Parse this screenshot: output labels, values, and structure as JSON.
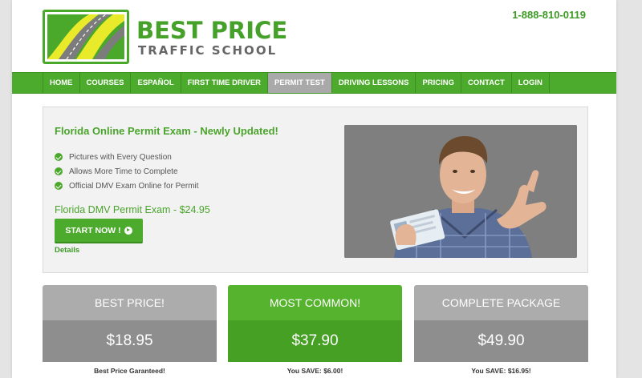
{
  "header": {
    "logo_line1": "BEST PRICE",
    "logo_line2": "TRAFFIC SCHOOL",
    "phone": "1-888-810-0119"
  },
  "nav": {
    "items": [
      "HOME",
      "COURSES",
      "ESPAÑOL",
      "FIRST TIME DRIVER",
      "PERMIT TEST",
      "DRIVING LESSONS",
      "PRICING",
      "CONTACT",
      "LOGIN"
    ],
    "active": "PERMIT TEST"
  },
  "promo": {
    "title": "Florida Online Permit Exam - Newly Updated!",
    "features": [
      "Pictures with Every Question",
      "Allows More Time to Complete",
      "Official DMV Exam Online for Permit"
    ],
    "price_line": "Florida DMV Permit Exam - $24.95",
    "cta_label": "START NOW !",
    "details_label": "Details"
  },
  "pricing": [
    {
      "heading": "BEST PRICE!",
      "price": "$18.95",
      "note": "Best Price Garanteed!",
      "color": "#acacac"
    },
    {
      "heading": "MOST COMMON!",
      "price": "$37.90",
      "note": "You SAVE: $6.00!",
      "color": "#56b32e"
    },
    {
      "heading": "COMPLETE PACKAGE",
      "price": "$49.90",
      "note": "You SAVE: $16.95!",
      "color": "#acacac"
    }
  ],
  "colors": {
    "brand_green": "#4cab2c",
    "nav_active": "#a9a9a9",
    "text_green": "#4aa42b"
  }
}
